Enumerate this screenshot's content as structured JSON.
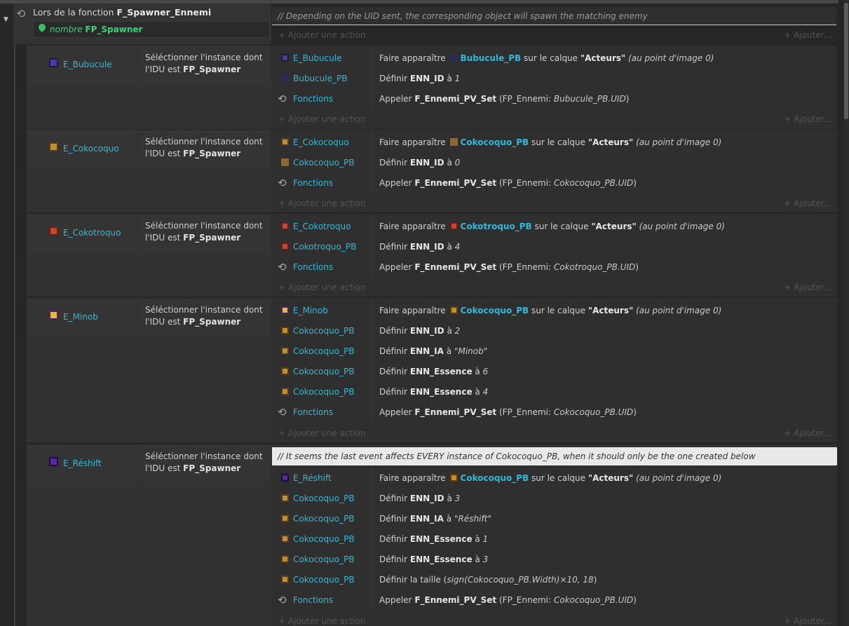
{
  "function": {
    "prefix": "Lors de la fonction",
    "name": "F_Spawner_Ennemi",
    "param_type": "nombre",
    "param_name": "FP_Spawner"
  },
  "comments": {
    "top": "//   Depending on the UID sent, the corresponding object will spawn the matching enemy",
    "reshift": "//   It seems the last event affects EVERY instance of Cokocoquo_PB, when it should only be the one created below"
  },
  "labels": {
    "add_action": "+ Ajouter une action",
    "add_more": "+ Ajouter...",
    "cond_line1": "Séléctionner l'instance dont",
    "cond_line2_prefix": "l'IDU est",
    "cond_param": "FP_Spawner",
    "functions": "Fonctions"
  },
  "events": [
    {
      "object": "E_Bubucule",
      "actions": [
        {
          "obj": "E_Bubucule",
          "pre": "Faire apparaître",
          "target": "Bubucule_PB",
          "mid": "sur le calque",
          "layer": "\"Acteurs\"",
          "tail": "(au point d'image 0)"
        },
        {
          "obj": "Bubucule_PB",
          "pre": "Définir",
          "var": "ENN_ID",
          "mid": "à",
          "val": "1"
        },
        {
          "obj": "Fonctions",
          "pre": "Appeler",
          "fn": "F_Ennemi_PV_Set",
          "mid": "(FP_Ennemi:",
          "val": "Bubucule_PB.UID",
          "end": ")"
        }
      ]
    },
    {
      "object": "E_Cokocoquo",
      "actions": [
        {
          "obj": "E_Cokocoquo",
          "pre": "Faire apparaître",
          "target": "Cokocoquo_PB",
          "mid": "sur le calque",
          "layer": "\"Acteurs\"",
          "tail": "(au point d'image 0)"
        },
        {
          "obj": "Cokocoquo_PB",
          "pre": "Définir",
          "var": "ENN_ID",
          "mid": "à",
          "val": "0"
        },
        {
          "obj": "Fonctions",
          "pre": "Appeler",
          "fn": "F_Ennemi_PV_Set",
          "mid": "(FP_Ennemi:",
          "val": "Cokocoquo_PB.UID",
          "end": ")"
        }
      ]
    },
    {
      "object": "E_Cokotroquo",
      "actions": [
        {
          "obj": "E_Cokotroquo",
          "pre": "Faire apparaître",
          "target": "Cokotroquo_PB",
          "mid": "sur le calque",
          "layer": "\"Acteurs\"",
          "tail": "(au point d'image 0)"
        },
        {
          "obj": "Cokotroquo_PB",
          "pre": "Définir",
          "var": "ENN_ID",
          "mid": "à",
          "val": "4"
        },
        {
          "obj": "Fonctions",
          "pre": "Appeler",
          "fn": "F_Ennemi_PV_Set",
          "mid": "(FP_Ennemi:",
          "val": "Cokotroquo_PB.UID",
          "end": ")"
        }
      ]
    },
    {
      "object": "E_Minob",
      "actions": [
        {
          "obj": "E_Minob",
          "pre": "Faire apparaître",
          "target": "Cokocoquo_PB",
          "mid": "sur le calque",
          "layer": "\"Acteurs\"",
          "tail": "(au point d'image 0)"
        },
        {
          "obj": "Cokocoquo_PB",
          "pre": "Définir",
          "var": "ENN_ID",
          "mid": "à",
          "val": "2"
        },
        {
          "obj": "Cokocoquo_PB",
          "pre": "Définir",
          "var": "ENN_IA",
          "mid": "à",
          "val": "\"Minob\""
        },
        {
          "obj": "Cokocoquo_PB",
          "pre": "Définir",
          "var": "ENN_Essence",
          "mid": "à",
          "val": "6"
        },
        {
          "obj": "Cokocoquo_PB",
          "pre": "Définir",
          "var": "ENN_Essence",
          "mid": "à",
          "val": "4"
        },
        {
          "obj": "Fonctions",
          "pre": "Appeler",
          "fn": "F_Ennemi_PV_Set",
          "mid": "(FP_Ennemi:",
          "val": "Cokocoquo_PB.UID",
          "end": ")"
        }
      ]
    },
    {
      "object": "E_Réshift",
      "actions": [
        {
          "obj": "E_Réshift",
          "pre": "Faire apparaître",
          "target": "Cokocoquo_PB",
          "mid": "sur le calque",
          "layer": "\"Acteurs\"",
          "tail": "(au point d'image 0)"
        },
        {
          "obj": "Cokocoquo_PB",
          "pre": "Définir",
          "var": "ENN_ID",
          "mid": "à",
          "val": "3"
        },
        {
          "obj": "Cokocoquo_PB",
          "pre": "Définir",
          "var": "ENN_IA",
          "mid": "à",
          "val": "\"Réshift\""
        },
        {
          "obj": "Cokocoquo_PB",
          "pre": "Définir",
          "var": "ENN_Essence",
          "mid": "à",
          "val": "1"
        },
        {
          "obj": "Cokocoquo_PB",
          "pre": "Définir",
          "var": "ENN_Essence",
          "mid": "à",
          "val": "3"
        },
        {
          "obj": "Cokocoquo_PB",
          "pre": "Définir la taille",
          "open": "(",
          "val": "sign(Cokocoquo_PB.Width)×10, 18",
          "end": ")"
        },
        {
          "obj": "Fonctions",
          "pre": "Appeler",
          "fn": "F_Ennemi_PV_Set",
          "mid": "(FP_Ennemi:",
          "val": "Cokocoquo_PB.UID",
          "end": ")"
        }
      ]
    }
  ]
}
